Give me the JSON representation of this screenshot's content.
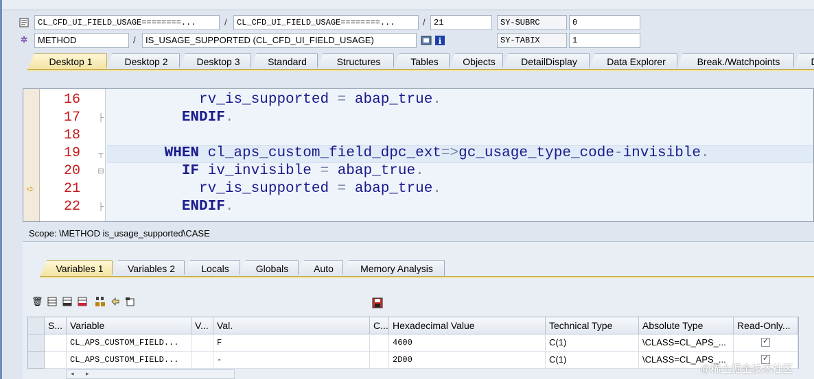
{
  "header": {
    "row1": {
      "program": "CL_CFD_UI_FIELD_USAGE========...",
      "include": "CL_CFD_UI_FIELD_USAGE========...",
      "line": "21",
      "sysfield_label": "SY-SUBRC",
      "sysfield_value": "0"
    },
    "row2": {
      "event_type": "METHOD",
      "event_name": "IS_USAGE_SUPPORTED (CL_CFD_UI_FIELD_USAGE)",
      "sysfield_label": "SY-TABIX",
      "sysfield_value": "1"
    },
    "separator": "/"
  },
  "desktop_tabs": [
    "Desktop 1",
    "Desktop 2",
    "Desktop 3",
    "Standard",
    "Structures",
    "Tables",
    "Objects",
    "DetailDisplay",
    "Data Explorer",
    "Break./Watchpoints",
    "Dif"
  ],
  "editor": {
    "lines": [
      {
        "num": "16",
        "indent": "          ",
        "parts": [
          [
            "id",
            "rv_is_supported "
          ],
          [
            "op",
            "= "
          ],
          [
            "id",
            "abap_true"
          ],
          [
            "op",
            "."
          ]
        ]
      },
      {
        "num": "17",
        "indent": "        ",
        "parts": [
          [
            "kw",
            "ENDIF"
          ],
          [
            "op",
            "."
          ]
        ]
      },
      {
        "num": "18",
        "indent": "",
        "parts": []
      },
      {
        "num": "19",
        "indent": "      ",
        "parts": [
          [
            "kw",
            "WHEN "
          ],
          [
            "id",
            "cl_aps_custom_field_dpc_ext"
          ],
          [
            "op",
            "=>"
          ],
          [
            "id",
            "gc_usage_type_code"
          ],
          [
            "op",
            "-"
          ],
          [
            "id",
            "invisible"
          ],
          [
            "op",
            "."
          ]
        ]
      },
      {
        "num": "20",
        "indent": "        ",
        "parts": [
          [
            "kw",
            "IF "
          ],
          [
            "id",
            "iv_invisible "
          ],
          [
            "op",
            "= "
          ],
          [
            "id",
            "abap_true"
          ],
          [
            "op",
            "."
          ]
        ]
      },
      {
        "num": "21",
        "indent": "          ",
        "parts": [
          [
            "id",
            "rv_is_supported "
          ],
          [
            "op",
            "= "
          ],
          [
            "id",
            "abap_true"
          ],
          [
            "op",
            "."
          ]
        ]
      },
      {
        "num": "22",
        "indent": "        ",
        "parts": [
          [
            "kw",
            "ENDIF"
          ],
          [
            "op",
            "."
          ]
        ]
      }
    ]
  },
  "scope_text": "Scope: \\METHOD is_usage_supported\\CASE",
  "variable_tabs": [
    "Variables 1",
    "Variables 2",
    "Locals",
    "Globals",
    "Auto",
    "Memory Analysis"
  ],
  "grid": {
    "columns": [
      "S...",
      "Variable",
      "V...",
      "Val.",
      "C...",
      "Hexadecimal Value",
      "Technical Type",
      "Absolute Type",
      "Read-Only..."
    ],
    "rows": [
      {
        "variable": "CL_APS_CUSTOM_FIELD...",
        "val": "F",
        "hex": "4600",
        "tech": "C(1)",
        "abs": "\\CLASS=CL_APS_...",
        "readonly": "✓"
      },
      {
        "variable": "CL_APS_CUSTOM_FIELD...",
        "val": "-",
        "hex": "2D00",
        "tech": "C(1)",
        "abs": "\\CLASS=CL_APS_...",
        "readonly": "✓"
      }
    ]
  },
  "watermark": "@稀土掘金技术社区"
}
